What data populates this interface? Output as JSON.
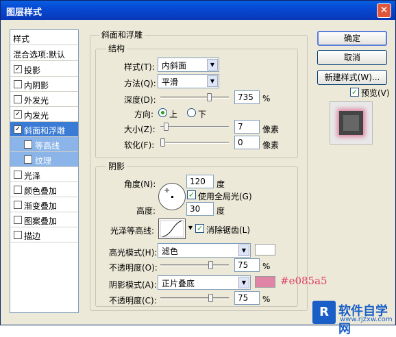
{
  "window": {
    "title": "图层样式"
  },
  "left_panel": {
    "items": [
      {
        "label": "样式",
        "checkbox": false
      },
      {
        "label": "混合选项:默认",
        "checkbox": false
      },
      {
        "label": "投影",
        "checkbox": true,
        "checked": true
      },
      {
        "label": "内阴影",
        "checkbox": true,
        "checked": false
      },
      {
        "label": "外发光",
        "checkbox": true,
        "checked": false
      },
      {
        "label": "内发光",
        "checkbox": true,
        "checked": true
      },
      {
        "label": "斜面和浮雕",
        "checkbox": true,
        "checked": true,
        "selected": true
      },
      {
        "label": "等高线",
        "checkbox": true,
        "checked": false,
        "sub": true
      },
      {
        "label": "纹理",
        "checkbox": true,
        "checked": false,
        "sub": true
      },
      {
        "label": "光泽",
        "checkbox": true,
        "checked": false
      },
      {
        "label": "颜色叠加",
        "checkbox": true,
        "checked": false
      },
      {
        "label": "渐变叠加",
        "checkbox": true,
        "checked": false
      },
      {
        "label": "图案叠加",
        "checkbox": true,
        "checked": false
      },
      {
        "label": "描边",
        "checkbox": true,
        "checked": false
      }
    ]
  },
  "bevel": {
    "group_title": "斜面和浮雕",
    "structure_title": "结构",
    "style_label": "样式(T):",
    "style_value": "内斜面",
    "technique_label": "方法(Q):",
    "technique_value": "平滑",
    "depth_label": "深度(D):",
    "depth_value": "735",
    "depth_unit": "%",
    "depth_level": 0.73,
    "direction_label": "方向:",
    "direction_up": "上",
    "direction_down": "下",
    "size_label": "大小(Z):",
    "size_value": "7",
    "size_unit": "像素",
    "size_level": 0.05,
    "soften_label": "软化(F):",
    "soften_value": "0",
    "soften_unit": "像素",
    "soften_level": 0
  },
  "shading": {
    "title": "阴影",
    "angle_label": "角度(N):",
    "angle_value": "120",
    "angle_unit": "度",
    "global_light_label": "使用全局光(G)",
    "altitude_label": "高度:",
    "altitude_value": "30",
    "altitude_unit": "度",
    "gloss_contour_label": "光泽等高线:",
    "antialias_label": "消除锯齿(L)",
    "highlight_mode_label": "高光模式(H):",
    "highlight_mode_value": "滤色",
    "highlight_color": "#ffffff",
    "highlight_opacity_label": "不透明度(O):",
    "highlight_opacity_value": "75",
    "highlight_opacity_unit": "%",
    "highlight_opacity_level": 0.75,
    "shadow_mode_label": "阴影模式(A):",
    "shadow_mode_value": "正片叠底",
    "shadow_color": "#e085a5",
    "shadow_opacity_label": "不透明度(C):",
    "shadow_opacity_value": "75",
    "shadow_opacity_unit": "%",
    "shadow_opacity_level": 0.75
  },
  "buttons": {
    "ok": "确定",
    "cancel": "取消",
    "new_style": "新建样式(W)...",
    "preview_label": "预览(V)"
  },
  "annotation": {
    "hex_note": "#e085a5"
  },
  "watermark": {
    "name": "软件自学网",
    "url": "www.rjzxw.com"
  }
}
